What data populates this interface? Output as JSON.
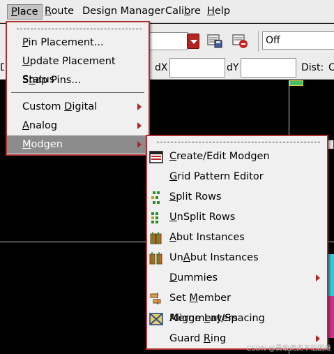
{
  "menubar": {
    "items": [
      {
        "pre": "",
        "u": "P",
        "post": "lace"
      },
      {
        "pre": "",
        "u": "R",
        "post": "oute"
      },
      {
        "pre": "Design Manager",
        "u": "",
        "post": ""
      },
      {
        "pre": "Cali",
        "u": "b",
        "post": "re"
      },
      {
        "pre": "",
        "u": "H",
        "post": "elp"
      }
    ]
  },
  "toolbar": {
    "off_value": "Off",
    "dx_label": "dX",
    "dy_label": "dY",
    "dist_label": "Dist:",
    "clip_d": "D",
    "clip_c": "C"
  },
  "place_menu": {
    "items": [
      {
        "pre": "",
        "u": "P",
        "post": "in Placement..."
      },
      {
        "pre": "",
        "u": "U",
        "post": "pdate Placement Status"
      },
      {
        "pre": "S",
        "u": "n",
        "post": "ap Pins..."
      },
      {
        "pre": "Custom ",
        "u": "D",
        "post": "igital"
      },
      {
        "pre": "",
        "u": "A",
        "post": "nalog"
      },
      {
        "pre": "",
        "u": "M",
        "post": "odgen"
      }
    ]
  },
  "modgen_menu": {
    "items": [
      {
        "pre": "",
        "u": "C",
        "post": "reate/Edit Modgen",
        "icon": "modgen-table-icon"
      },
      {
        "pre": "",
        "u": "G",
        "post": "rid Pattern Editor",
        "icon": ""
      },
      {
        "pre": "",
        "u": "S",
        "post": "plit Rows",
        "icon": "split-rows-icon"
      },
      {
        "pre": "",
        "u": "U",
        "post": "nSplit Rows",
        "icon": "unsplit-rows-icon"
      },
      {
        "pre": "",
        "u": "A",
        "post": "but Instances",
        "icon": "abut-icon"
      },
      {
        "pre": "Un",
        "u": "A",
        "post": "but Instances",
        "icon": "unabut-icon"
      },
      {
        "pre": "",
        "u": "D",
        "post": "ummies",
        "icon": ""
      },
      {
        "pre": "Set ",
        "u": "M",
        "post": "ember Alignment/Spacing",
        "icon": "alignment-icon"
      },
      {
        "pre": "Merge ",
        "u": "L",
        "post": "ayers",
        "icon": "merge-layers-icon"
      },
      {
        "pre": "Guard ",
        "u": "R",
        "post": "ing",
        "icon": ""
      }
    ]
  },
  "watermark": "CSDN @勇敢虎虎不怕困难",
  "colors": {
    "menu_border": "#b03030",
    "highlight": "#8c8c8c",
    "arrow": "#b22323",
    "background": "#000000"
  }
}
